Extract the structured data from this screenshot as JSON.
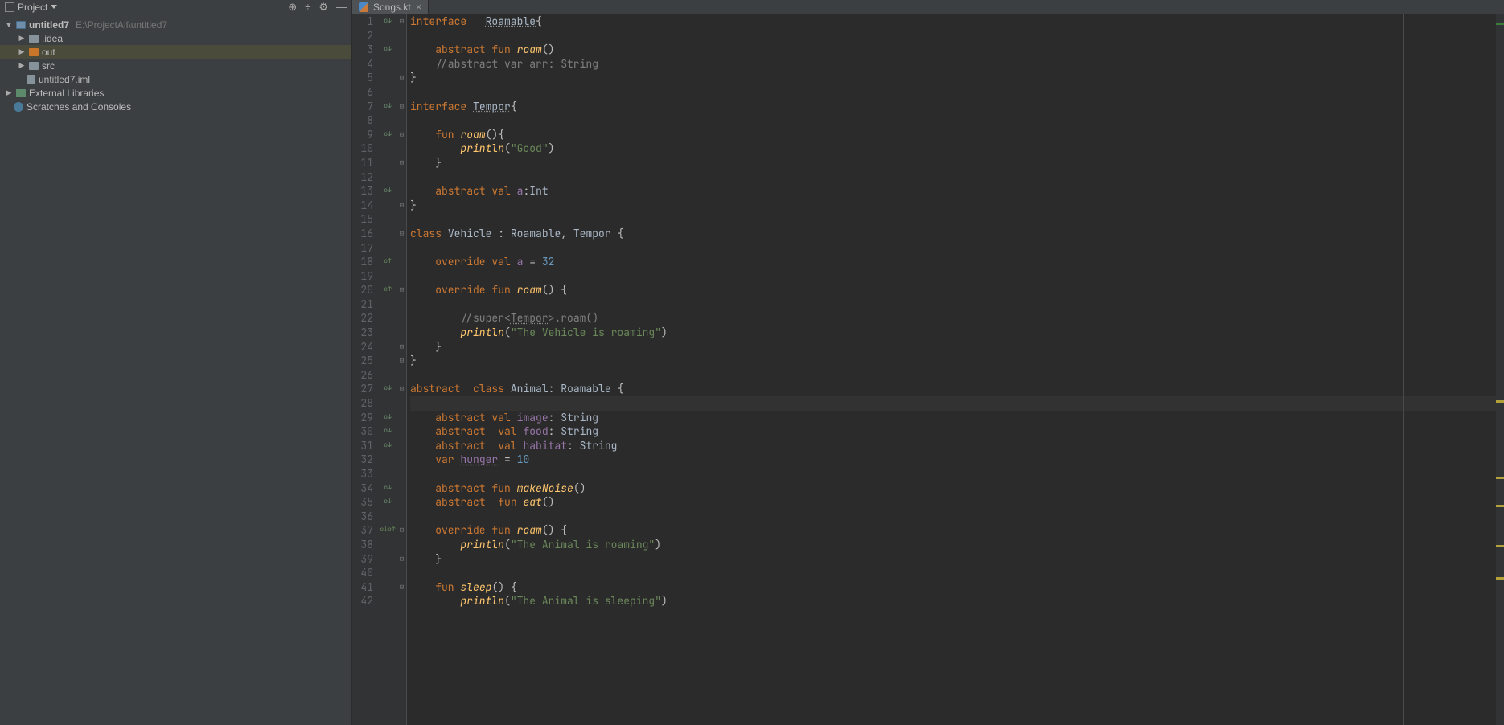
{
  "sidebar": {
    "title": "Project",
    "icons": [
      "target",
      "collapse",
      "settings",
      "hide"
    ],
    "tree": {
      "root_label": "untitled7",
      "root_path": "E:\\ProjectAll\\untitled7",
      "children": [
        {
          "label": ".idea",
          "type": "folder"
        },
        {
          "label": "out",
          "type": "folder-orange",
          "selected": true
        },
        {
          "label": "src",
          "type": "folder"
        },
        {
          "label": "untitled7.iml",
          "type": "file"
        }
      ],
      "external": "External Libraries",
      "scratches": "Scratches and Consoles"
    }
  },
  "tab": {
    "label": "Songs.kt"
  },
  "code_lines": [
    {
      "n": 1,
      "annot": "o↓",
      "fold": "⊟",
      "tokens": [
        [
          "kw",
          "interface"
        ],
        [
          "",
          "   "
        ],
        [
          "type underline",
          "Roamable"
        ],
        [
          "",
          "{"
        ]
      ]
    },
    {
      "n": 2,
      "tokens": []
    },
    {
      "n": 3,
      "annot": "o↓",
      "tokens": [
        [
          "",
          "    "
        ],
        [
          "kw",
          "abstract"
        ],
        [
          "",
          " "
        ],
        [
          "kw",
          "fun"
        ],
        [
          "",
          " "
        ],
        [
          "fn",
          "roam"
        ],
        [
          "",
          "()"
        ]
      ]
    },
    {
      "n": 4,
      "tokens": [
        [
          "",
          "    "
        ],
        [
          "comment",
          "//abstract var arr: String"
        ]
      ]
    },
    {
      "n": 5,
      "fold": "⊟",
      "tokens": [
        [
          "",
          "}"
        ]
      ]
    },
    {
      "n": 6,
      "tokens": []
    },
    {
      "n": 7,
      "annot": "o↓",
      "fold": "⊟",
      "tokens": [
        [
          "kw",
          "interface"
        ],
        [
          "",
          " "
        ],
        [
          "type underline",
          "Tempor"
        ],
        [
          "",
          "{"
        ]
      ]
    },
    {
      "n": 8,
      "tokens": []
    },
    {
      "n": 9,
      "annot": "o↓",
      "fold": "⊟",
      "tokens": [
        [
          "",
          "    "
        ],
        [
          "kw",
          "fun"
        ],
        [
          "",
          " "
        ],
        [
          "fn",
          "roam"
        ],
        [
          "",
          "(){"
        ]
      ]
    },
    {
      "n": 10,
      "tokens": [
        [
          "",
          "        "
        ],
        [
          "fn",
          "println"
        ],
        [
          "",
          "("
        ],
        [
          "str",
          "\"Good\""
        ],
        [
          "",
          ")"
        ]
      ]
    },
    {
      "n": 11,
      "fold": "⊟",
      "tokens": [
        [
          "",
          "    }"
        ]
      ]
    },
    {
      "n": 12,
      "tokens": []
    },
    {
      "n": 13,
      "annot": "o↓",
      "tokens": [
        [
          "",
          "    "
        ],
        [
          "kw",
          "abstract"
        ],
        [
          "",
          " "
        ],
        [
          "kw",
          "val"
        ],
        [
          "",
          " "
        ],
        [
          "member",
          "a"
        ],
        [
          "",
          ":"
        ],
        [
          "type",
          "Int"
        ]
      ]
    },
    {
      "n": 14,
      "fold": "⊟",
      "tokens": [
        [
          "",
          "}"
        ]
      ]
    },
    {
      "n": 15,
      "tokens": []
    },
    {
      "n": 16,
      "fold": "⊟",
      "tokens": [
        [
          "kw",
          "class"
        ],
        [
          "",
          " "
        ],
        [
          "type",
          "Vehicle"
        ],
        [
          "",
          " : "
        ],
        [
          "type",
          "Roamable"
        ],
        [
          "",
          ", "
        ],
        [
          "type",
          "Tempor"
        ],
        [
          "",
          " {"
        ]
      ]
    },
    {
      "n": 17,
      "tokens": []
    },
    {
      "n": 18,
      "annot": "o↑",
      "tokens": [
        [
          "",
          "    "
        ],
        [
          "kw",
          "override"
        ],
        [
          "",
          " "
        ],
        [
          "kw",
          "val"
        ],
        [
          "",
          " "
        ],
        [
          "member",
          "a"
        ],
        [
          "",
          " = "
        ],
        [
          "num",
          "32"
        ]
      ]
    },
    {
      "n": 19,
      "tokens": []
    },
    {
      "n": 20,
      "annot": "o↑",
      "fold": "⊟",
      "tokens": [
        [
          "",
          "    "
        ],
        [
          "kw",
          "override"
        ],
        [
          "",
          " "
        ],
        [
          "kw",
          "fun"
        ],
        [
          "",
          " "
        ],
        [
          "fn",
          "roam"
        ],
        [
          "",
          "() {"
        ]
      ]
    },
    {
      "n": 21,
      "tokens": []
    },
    {
      "n": 22,
      "tokens": [
        [
          "",
          "        "
        ],
        [
          "comment",
          "//super<"
        ],
        [
          "comment underline",
          "Tempor"
        ],
        [
          "comment",
          ">.roam()"
        ]
      ]
    },
    {
      "n": 23,
      "tokens": [
        [
          "",
          "        "
        ],
        [
          "fn",
          "println"
        ],
        [
          "",
          "("
        ],
        [
          "str",
          "\"The Vehicle is roaming\""
        ],
        [
          "",
          ")"
        ]
      ]
    },
    {
      "n": 24,
      "fold": "⊟",
      "tokens": [
        [
          "",
          "    }"
        ]
      ]
    },
    {
      "n": 25,
      "fold": "⊟",
      "tokens": [
        [
          "",
          "}"
        ]
      ]
    },
    {
      "n": 26,
      "tokens": []
    },
    {
      "n": 27,
      "annot": "o↓",
      "fold": "⊟",
      "tokens": [
        [
          "kw",
          "abstract"
        ],
        [
          "",
          "  "
        ],
        [
          "kw",
          "class"
        ],
        [
          "",
          " "
        ],
        [
          "type",
          "Animal"
        ],
        [
          "",
          ": "
        ],
        [
          "type",
          "Roamable"
        ],
        [
          "",
          " {"
        ]
      ]
    },
    {
      "n": 28,
      "current": true,
      "tokens": []
    },
    {
      "n": 29,
      "annot": "o↓",
      "tokens": [
        [
          "",
          "    "
        ],
        [
          "kw",
          "abstract"
        ],
        [
          "",
          " "
        ],
        [
          "kw",
          "val"
        ],
        [
          "",
          " "
        ],
        [
          "member",
          "image"
        ],
        [
          "",
          ": "
        ],
        [
          "type",
          "String"
        ]
      ]
    },
    {
      "n": 30,
      "annot": "o↓",
      "tokens": [
        [
          "",
          "    "
        ],
        [
          "kw",
          "abstract"
        ],
        [
          "",
          "  "
        ],
        [
          "kw",
          "val"
        ],
        [
          "",
          " "
        ],
        [
          "member",
          "food"
        ],
        [
          "",
          ": "
        ],
        [
          "type",
          "String"
        ]
      ]
    },
    {
      "n": 31,
      "annot": "o↓",
      "tokens": [
        [
          "",
          "    "
        ],
        [
          "kw",
          "abstract"
        ],
        [
          "",
          "  "
        ],
        [
          "kw",
          "val"
        ],
        [
          "",
          " "
        ],
        [
          "member",
          "habitat"
        ],
        [
          "",
          ": "
        ],
        [
          "type",
          "String"
        ]
      ]
    },
    {
      "n": 32,
      "tokens": [
        [
          "",
          "    "
        ],
        [
          "kw",
          "var"
        ],
        [
          "",
          " "
        ],
        [
          "member underline",
          "hunger"
        ],
        [
          "",
          " = "
        ],
        [
          "num",
          "10"
        ]
      ]
    },
    {
      "n": 33,
      "tokens": []
    },
    {
      "n": 34,
      "annot": "o↓",
      "tokens": [
        [
          "",
          "    "
        ],
        [
          "kw",
          "abstract"
        ],
        [
          "",
          " "
        ],
        [
          "kw",
          "fun"
        ],
        [
          "",
          " "
        ],
        [
          "fn",
          "makeNoise"
        ],
        [
          "",
          "()"
        ]
      ]
    },
    {
      "n": 35,
      "annot": "o↓",
      "tokens": [
        [
          "",
          "    "
        ],
        [
          "kw",
          "abstract"
        ],
        [
          "",
          "  "
        ],
        [
          "kw",
          "fun"
        ],
        [
          "",
          " "
        ],
        [
          "fn",
          "eat"
        ],
        [
          "",
          "()"
        ]
      ]
    },
    {
      "n": 36,
      "tokens": []
    },
    {
      "n": 37,
      "annot": "o↓o↑",
      "fold": "⊟",
      "tokens": [
        [
          "",
          "    "
        ],
        [
          "kw",
          "override"
        ],
        [
          "",
          " "
        ],
        [
          "kw",
          "fun"
        ],
        [
          "",
          " "
        ],
        [
          "fn",
          "roam"
        ],
        [
          "",
          "() {"
        ]
      ]
    },
    {
      "n": 38,
      "tokens": [
        [
          "",
          "        "
        ],
        [
          "fn",
          "println"
        ],
        [
          "",
          "("
        ],
        [
          "str",
          "\"The Animal is roaming\""
        ],
        [
          "",
          ")"
        ]
      ]
    },
    {
      "n": 39,
      "fold": "⊟",
      "tokens": [
        [
          "",
          "    }"
        ]
      ]
    },
    {
      "n": 40,
      "tokens": []
    },
    {
      "n": 41,
      "fold": "⊟",
      "tokens": [
        [
          "",
          "    "
        ],
        [
          "kw",
          "fun"
        ],
        [
          "",
          " "
        ],
        [
          "fn",
          "sleep"
        ],
        [
          "",
          "() {"
        ]
      ]
    },
    {
      "n": 42,
      "tokens": [
        [
          "",
          "        "
        ],
        [
          "fn",
          "println"
        ],
        [
          "",
          "("
        ],
        [
          "str",
          "\"The Animal is sleeping\""
        ],
        [
          "",
          ")"
        ]
      ]
    }
  ]
}
